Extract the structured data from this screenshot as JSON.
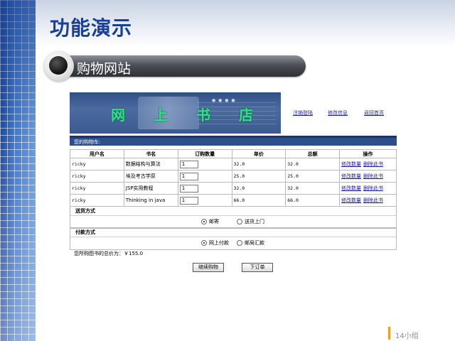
{
  "slide": {
    "title": "功能演示",
    "section_label": "购物网站",
    "page_number": "14小组"
  },
  "app": {
    "banner_chars": [
      "网",
      "上",
      "书",
      "店"
    ],
    "banner_dots": "● ● ● ●",
    "top_links": [
      "注销登陆",
      "修改信息",
      "返回首页"
    ],
    "cart_header": "您的购物车:",
    "table": {
      "headers": [
        "用户名",
        "书名",
        "订购数量",
        "单价",
        "总额",
        "操作"
      ],
      "rows": [
        {
          "user": "ricky",
          "book": "数据结构与算法",
          "qty": "1",
          "price": "32.0",
          "total": "32.0"
        },
        {
          "user": "ricky",
          "book": "埃及考古学原",
          "qty": "1",
          "price": "25.0",
          "total": "25.0"
        },
        {
          "user": "ricky",
          "book": "JSP实用教程",
          "qty": "1",
          "price": "32.0",
          "total": "32.0"
        },
        {
          "user": "ricky",
          "book": "Thinking in java",
          "qty": "1",
          "price": "66.0",
          "total": "66.0"
        }
      ],
      "ops": {
        "modify": "修改数量",
        "delete": "删除此书"
      }
    },
    "delivery": {
      "label": "送货方式",
      "options": [
        {
          "label": "邮寄",
          "selected": true
        },
        {
          "label": "送货上门",
          "selected": false
        }
      ]
    },
    "payment": {
      "label": "付款方式",
      "options": [
        {
          "label": "网上付款",
          "selected": true
        },
        {
          "label": "邮局汇款",
          "selected": false
        }
      ]
    },
    "total_text": "您所购图书的总价为：￥155.0",
    "buttons": {
      "continue": "继续购物",
      "order": "下订单"
    }
  }
}
